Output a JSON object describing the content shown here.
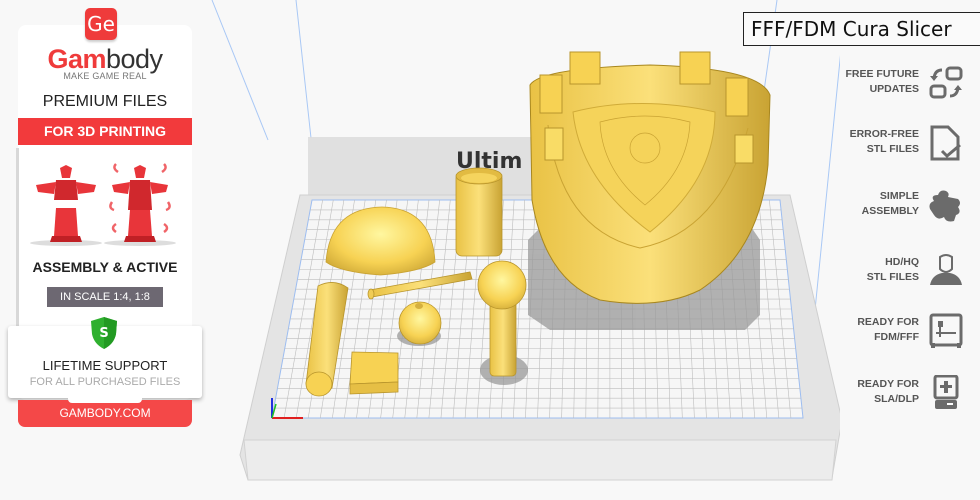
{
  "promo": {
    "logo_badge": "Ge",
    "brand_part1": "Gam",
    "brand_part2": "body",
    "tagline": "MAKE GAME REAL",
    "heading": "PREMIUM FILES",
    "banner": "FOR 3D PRINTING",
    "assembly_label": "ASSEMBLY & ACTIVE",
    "scale_label": "IN SCALE 1:4, 1:8",
    "support_title": "LIFETIME SUPPORT",
    "support_subtitle": "FOR ALL PURCHASED FILES",
    "shield_letter": "S",
    "site": "GAMBODY.COM"
  },
  "title_box": "FFF/FDM Cura Slicer",
  "viewport": {
    "bed_logo_text": "Ultim",
    "model_color": "#f7d253",
    "shadow_color": "#9a9a9a"
  },
  "features": [
    {
      "line1": "FREE FUTURE",
      "line2": "UPDATES",
      "icon": "update-arrows-icon"
    },
    {
      "line1": "ERROR-FREE",
      "line2": "STL FILES",
      "icon": "file-check-icon"
    },
    {
      "line1": "SIMPLE",
      "line2": "ASSEMBLY",
      "icon": "puzzle-icon"
    },
    {
      "line1": "HD/HQ",
      "line2": "STL FILES",
      "icon": "hero-bust-icon"
    },
    {
      "line1": "READY FOR",
      "line2": "FDM/FFF",
      "icon": "fdm-printer-icon"
    },
    {
      "line1": "READY FOR",
      "line2": "SLA/DLP",
      "icon": "sla-printer-icon"
    }
  ]
}
